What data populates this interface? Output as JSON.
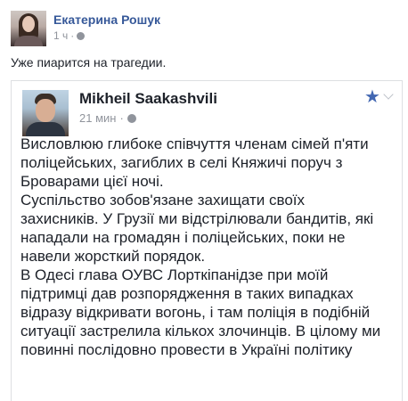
{
  "post": {
    "author": "Екатерина Рошук",
    "time": "1 ч",
    "separator": "·",
    "status": "Уже пиарится на трагедии."
  },
  "shared": {
    "author": "Mikheil Saakashvili",
    "time": "21 мин",
    "separator": "·",
    "lines": [
      "Висловлюю глибоке співчуття членам сімей п'яти",
      "поліцейських, загиблих в селі Княжичі поруч з",
      "Броварами цієї ночі.",
      "Суспільство зобов'язане захищати своїх",
      "захисників. У Грузії ми відстрілювали бандитів, які",
      "нападали на громадян і поліцейських, поки не",
      "навели жорсткий порядок.",
      "В Одесі глава ОУВС Лорткіпанідзе при моїй",
      "підтримці дав розпорядження в таких випадках",
      "відразу відкривати вогонь, і там поліція в подібній",
      "ситуації застрелила кількох злочинців. В цілому ми",
      "повинні послідовно провести в Україні політику"
    ]
  },
  "colors": {
    "link": "#365899",
    "meta": "#90949c",
    "accent_star": "#4267b2",
    "text": "#1d2129",
    "border": "#dddfe2"
  },
  "icons": {
    "privacy": "globe-icon",
    "follow": "star-icon",
    "menu": "chevron-down-icon"
  }
}
